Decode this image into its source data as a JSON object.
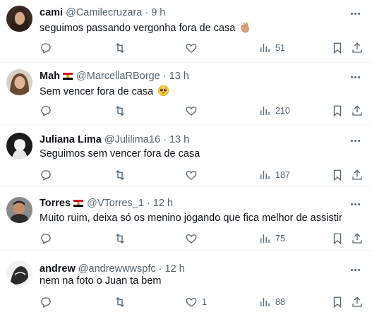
{
  "tweets": [
    {
      "name": "cami",
      "flag": false,
      "handle": "@Camilecruzara",
      "dot": "·",
      "time": "9 h",
      "text": "seguimos passando vergonha fora de casa",
      "emoji": "clapping-hands-icon",
      "replies": "",
      "retweets": "",
      "likes": "",
      "views": "51"
    },
    {
      "name": "Mah",
      "flag": true,
      "handle": "@MarcellaRBorge",
      "dot": "·",
      "time": "13 h",
      "text": "Sem vencer fora de casa",
      "emoji": "pleading-face-icon",
      "replies": "",
      "retweets": "",
      "likes": "",
      "views": "210"
    },
    {
      "name": "Juliana Lima",
      "flag": false,
      "handle": "@Julilima16",
      "dot": "·",
      "time": "13 h",
      "text": "Seguimos sem vencer fora de casa",
      "emoji": "",
      "replies": "",
      "retweets": "",
      "likes": "",
      "views": "187"
    },
    {
      "name": "Torres",
      "flag": true,
      "handle": "@VTorres_1",
      "dot": "·",
      "time": "12 h",
      "text": "Muito ruim, deixa só os menino jogando que fica melhor de assistir",
      "emoji": "",
      "replies": "",
      "retweets": "",
      "likes": "",
      "views": "75"
    },
    {
      "name": "andrew",
      "flag": false,
      "handle": "@andrewwwspfc",
      "dot": "·",
      "time": "12 h",
      "text": "nem na foto o Juan ta bem",
      "emoji": "",
      "replies": "",
      "retweets": "",
      "likes": "1",
      "views": "88"
    }
  ],
  "colors": {
    "text": "#0f1419",
    "secondary": "#536471",
    "divider": "#eff3f4",
    "flag_red": "#ce1126",
    "flag_white": "#ffffff",
    "flag_black": "#000000"
  }
}
